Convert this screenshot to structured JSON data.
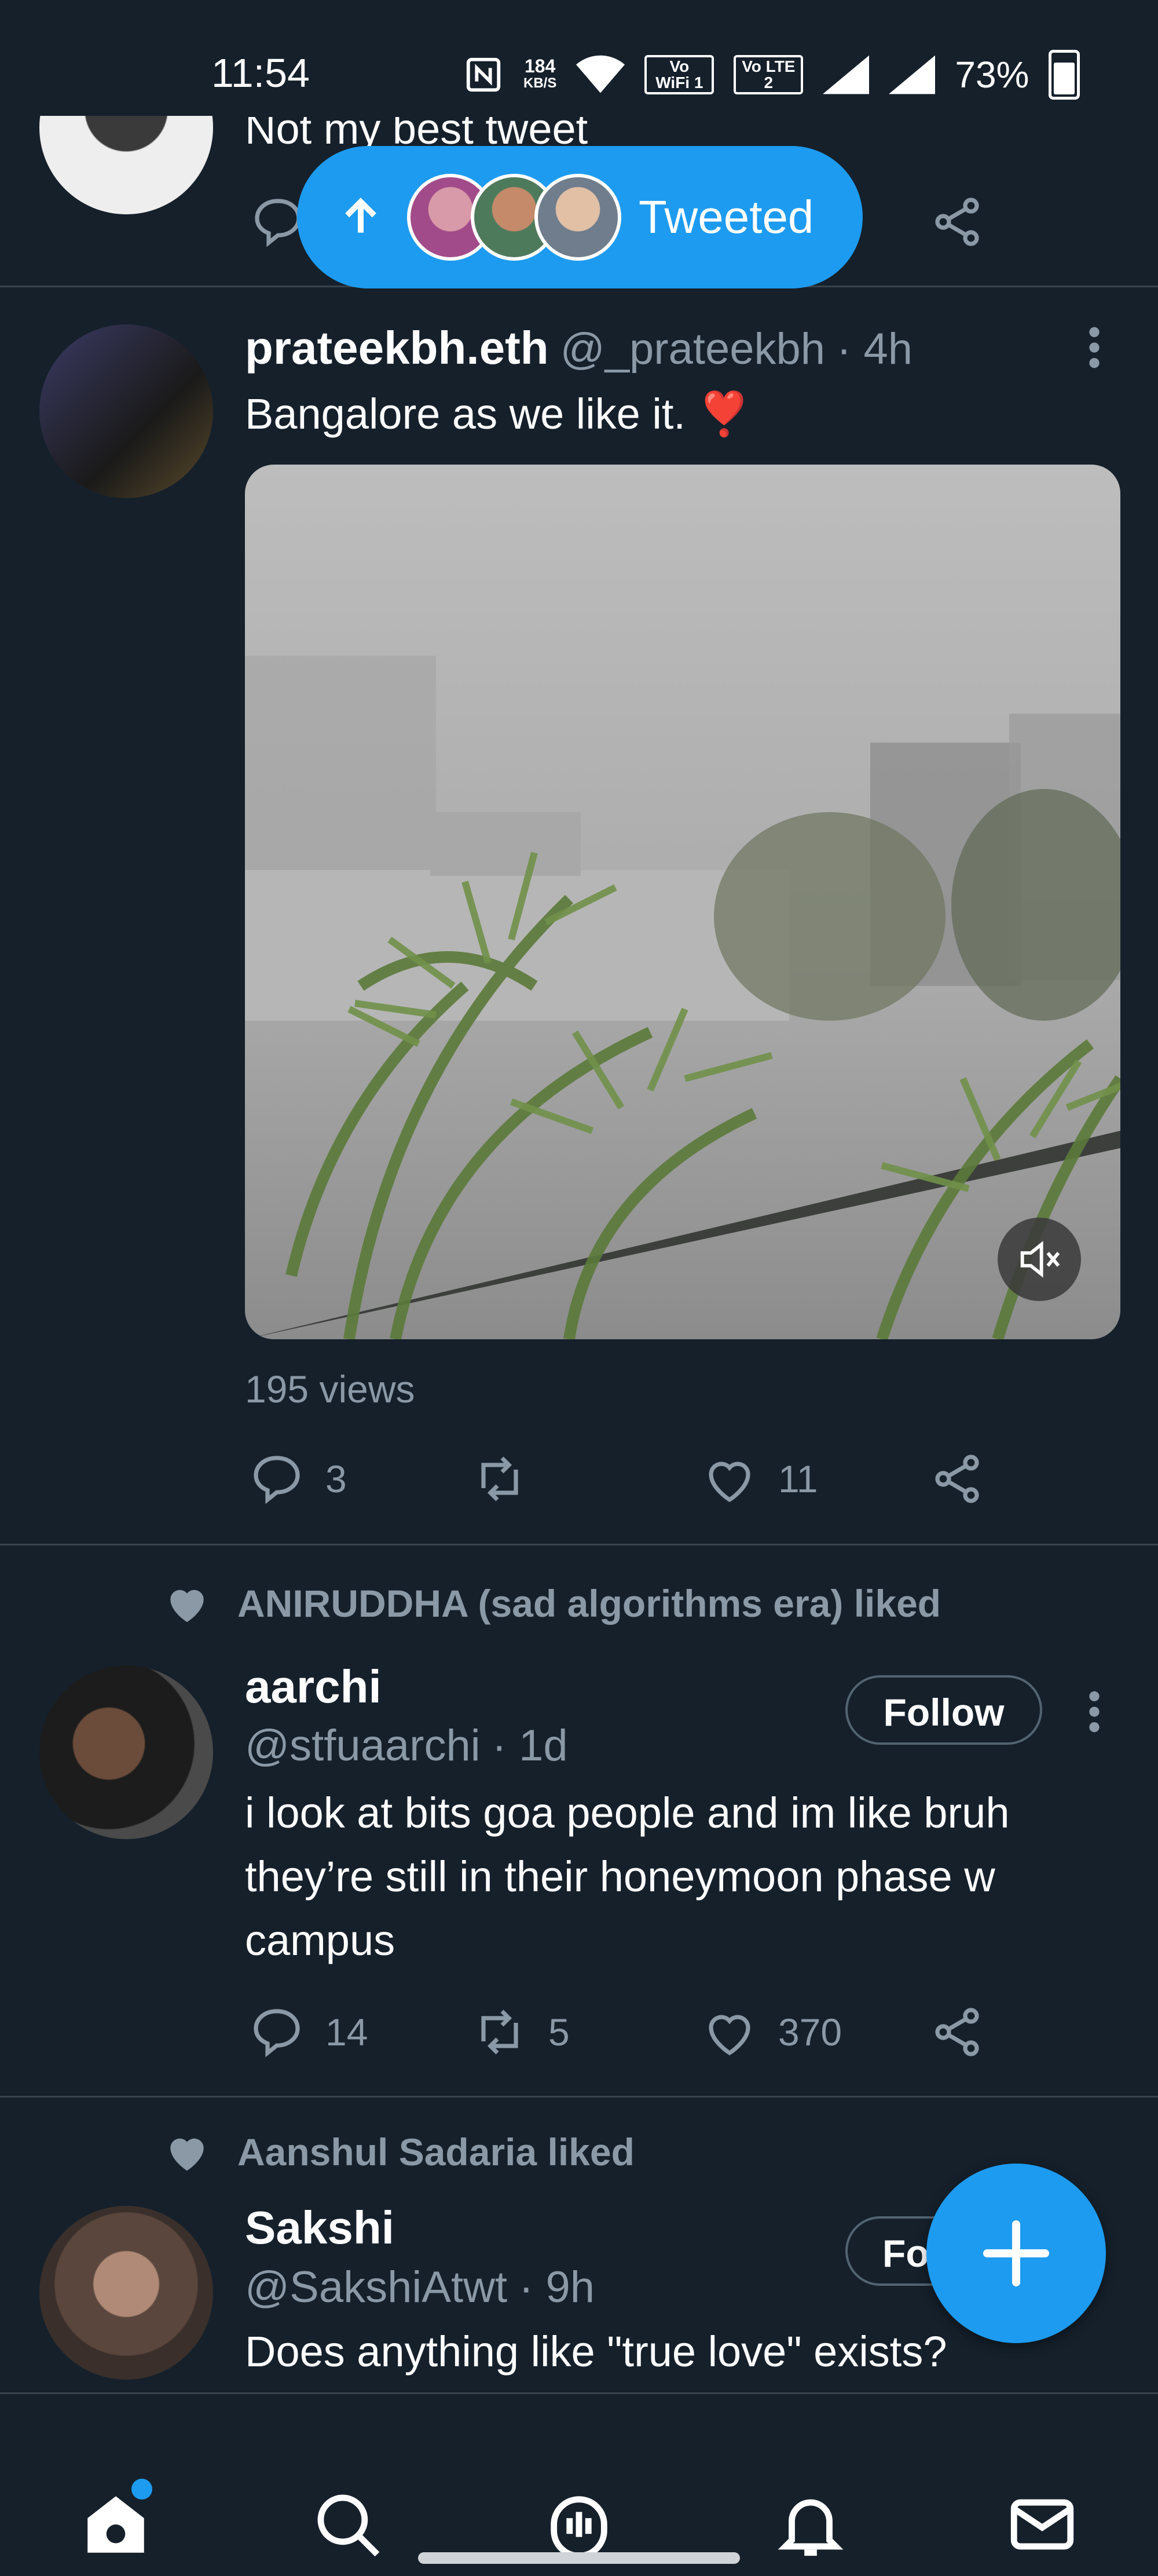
{
  "status_bar": {
    "time": "11:54",
    "data_rate_value": "184",
    "data_rate_unit": "KB/S",
    "wifi_badge": "Vo WiFi 1",
    "lte_badge": "Vo LTE 2",
    "battery": "73%"
  },
  "pill": {
    "label": "Tweeted",
    "icon": "arrow-up-icon"
  },
  "tweets": [
    {
      "text": "Not my best tweet"
    },
    {
      "name": "prateekbh.eth",
      "handle": "@_prateekbh",
      "time": "· 4h",
      "text": "Bangalore as we like it. ❣️",
      "views": "195 views",
      "reply_count": "3",
      "retweet_count": "",
      "like_count": "11"
    },
    {
      "liked_by": "ANIRUDDHA (sad algorithms era) liked",
      "name": "aarchi",
      "handle": "@stfuaarchi",
      "time": "· 1d",
      "follow_label": "Follow",
      "text_lines": [
        "i look at bits goa people and im like bruh",
        "they’re still in their honeymoon phase w",
        "campus"
      ],
      "reply_count": "14",
      "retweet_count": "5",
      "like_count": "370"
    },
    {
      "liked_by": "Aanshul Sadaria liked",
      "name": "Sakshi",
      "handle": "@SakshiAtwt",
      "time": "· 9h",
      "follow_label": "Fo",
      "text": "Does anything like \"true love\" exists?"
    }
  ],
  "bottom_nav": [
    "home-icon",
    "search-icon",
    "spaces-icon",
    "notifications-icon",
    "messages-icon"
  ],
  "colors": {
    "background": "#15202b",
    "accent": "#1d9bf0",
    "muted": "#8b98a5",
    "divider": "#38444d",
    "heart_red": "#e0245e"
  }
}
